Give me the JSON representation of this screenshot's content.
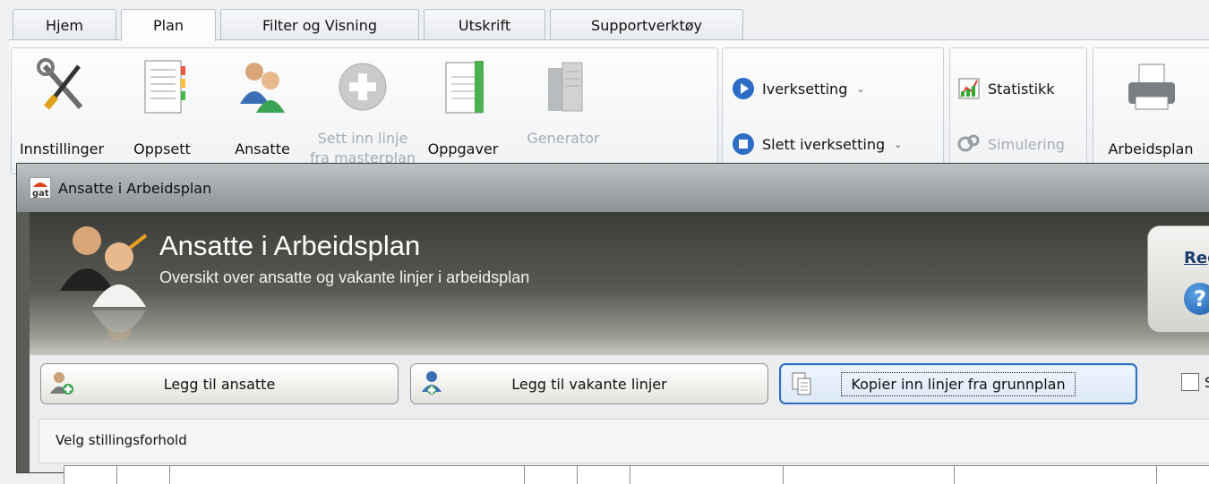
{
  "ribbon_tabs": [
    {
      "label": "Hjem"
    },
    {
      "label": "Plan"
    },
    {
      "label": "Filter og Visning"
    },
    {
      "label": "Utskrift"
    },
    {
      "label": "Supportverktøy"
    }
  ],
  "ribbon": {
    "innstillinger": "Innstillinger",
    "oppsett": "Oppsett",
    "ansatte": "Ansatte",
    "sett_inn_linje": "Sett inn linje fra masterplan",
    "oppgaver": "Oppgaver",
    "generator": "Generator",
    "iverksetting": "Iverksetting",
    "slett_iverksetting": "Slett iverksetting",
    "statistikk": "Statistikk",
    "simulering": "Simulering",
    "arbeidsplan": "Arbeidsplan"
  },
  "dialog": {
    "window_title": "Ansatte i Arbeidsplan",
    "header_title": "Ansatte i Arbeidsplan",
    "header_subtitle": "Oversikt over ansatte og vakante linjer i arbeidsplan",
    "help_link": "Reg",
    "help_icon": "?",
    "buttons": {
      "legg_til_ansatte": "Legg til ansatte",
      "legg_til_vakante": "Legg til vakante linjer",
      "kopier_inn": "Kopier inn linjer fra grunnplan"
    },
    "checkbox_label": "Sl",
    "section_title": "Velg stillingsforhold"
  },
  "icons": {
    "settings": "tools-icon",
    "setup": "notebook-icon",
    "employees": "people-icon",
    "insert": "plus-circle-icon",
    "tasks": "document-icon",
    "generator": "generator-icon",
    "play": "play-icon",
    "stop": "stop-icon",
    "stats": "chart-icon",
    "simulation": "simulation-icon",
    "printer": "printer-icon"
  }
}
